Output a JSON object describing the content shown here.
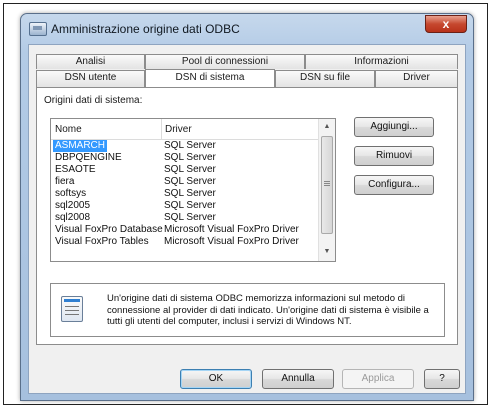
{
  "window": {
    "title": "Amministrazione origine dati ODBC",
    "close_label": "x"
  },
  "tabs": {
    "row1": [
      "Analisi",
      "Pool di connessioni",
      "Informazioni"
    ],
    "row2": [
      "DSN utente",
      "DSN di sistema",
      "DSN su file",
      "Driver"
    ],
    "active": "DSN di sistema"
  },
  "panel": {
    "label": "Origini dati di sistema:",
    "columns": [
      "Nome",
      "Driver"
    ],
    "rows": [
      {
        "name": "ASMARCH",
        "driver": "SQL Server",
        "selected": true
      },
      {
        "name": "DBPQENGINE",
        "driver": "SQL Server"
      },
      {
        "name": "ESAOTE",
        "driver": "SQL Server"
      },
      {
        "name": "fiera",
        "driver": "SQL Server"
      },
      {
        "name": "softsys",
        "driver": "SQL Server"
      },
      {
        "name": "sql2005",
        "driver": "SQL Server"
      },
      {
        "name": "sql2008",
        "driver": "SQL Server"
      },
      {
        "name": "Visual FoxPro Database",
        "driver": "Microsoft Visual FoxPro Driver"
      },
      {
        "name": "Visual FoxPro Tables",
        "driver": "Microsoft Visual FoxPro Driver"
      }
    ],
    "buttons": {
      "add": "Aggiungi...",
      "remove": "Rimuovi",
      "configure": "Configura..."
    },
    "info": "Un'origine dati di sistema ODBC memorizza informazioni sul metodo di connessione al provider di dati indicato. Un'origine dati di sistema è visibile a tutti gli utenti del computer, inclusi i servizi di Windows NT."
  },
  "footer": {
    "ok": "OK",
    "cancel": "Annulla",
    "apply": "Applica",
    "help": "?"
  }
}
